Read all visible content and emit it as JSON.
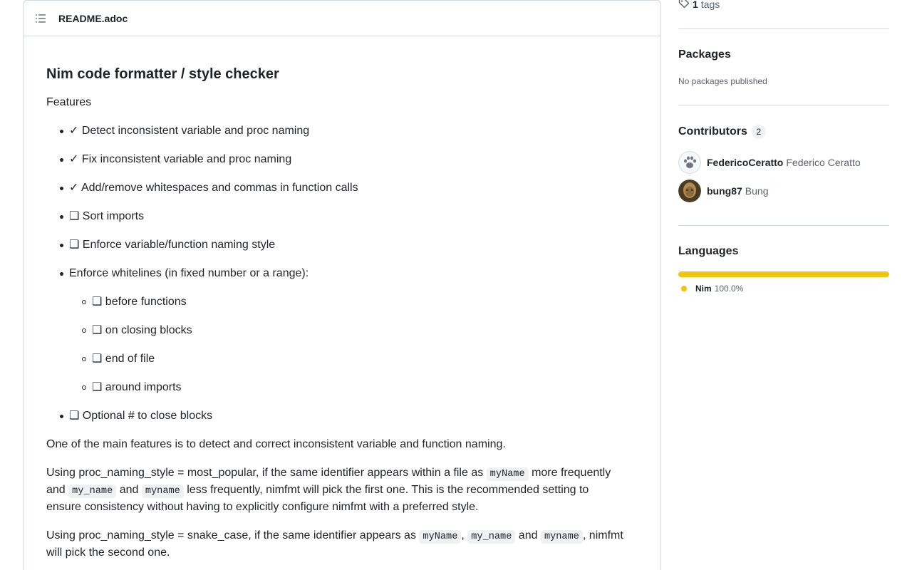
{
  "readme": {
    "filename": "README.adoc",
    "title": "Nim code formatter / style checker",
    "features_label": "Features",
    "items": [
      "✓ Detect inconsistent variable and proc naming",
      "✓ Fix inconsistent variable and proc naming",
      "✓ Add/remove whitespaces and commas in function calls",
      "❏ Sort imports",
      "❏ Enforce variable/function naming style",
      "Enforce whitelines (in fixed number or a range):"
    ],
    "subitems": [
      "❏ before functions",
      "❏ on closing blocks",
      "❏ end of file",
      "❏ around imports"
    ],
    "last_item": "❏ Optional # to close blocks",
    "p1": "One of the main features is to detect and correct inconsistent variable and function naming.",
    "p2": {
      "a": "Using proc_naming_style = most_popular, if the same identifier appears within a file as ",
      "code1": "myName",
      "b": " more frequently",
      "c": "and ",
      "code2": "my_name",
      "d": " and ",
      "code3": "myname",
      "e": " less frequently, nimfmt will pick the first one. This is the recommended setting to",
      "f": "ensure consistency without having to explicitly configure nimfmt with a preferred style."
    },
    "p3": {
      "a": "Using proc_naming_style = snake_case, if the same identifier appears as ",
      "code1": "myName",
      "b": ", ",
      "code2": "my_name",
      "c": " and ",
      "code3": "myname",
      "d": ", nimfmt",
      "e": "will pick the second one."
    }
  },
  "sidebar": {
    "tags_count": "1",
    "tags_label": "tags",
    "packages_heading": "Packages",
    "packages_text": "No packages published",
    "contributors_heading": "Contributors",
    "contributors_count": "2",
    "contributors": [
      {
        "login": "FedericoCeratto",
        "name": "Federico Ceratto"
      },
      {
        "login": "bung87",
        "name": "Bung"
      }
    ],
    "languages_heading": "Languages",
    "language": {
      "name": "Nim",
      "percent": "100.0%",
      "color": "#ffc200"
    }
  }
}
